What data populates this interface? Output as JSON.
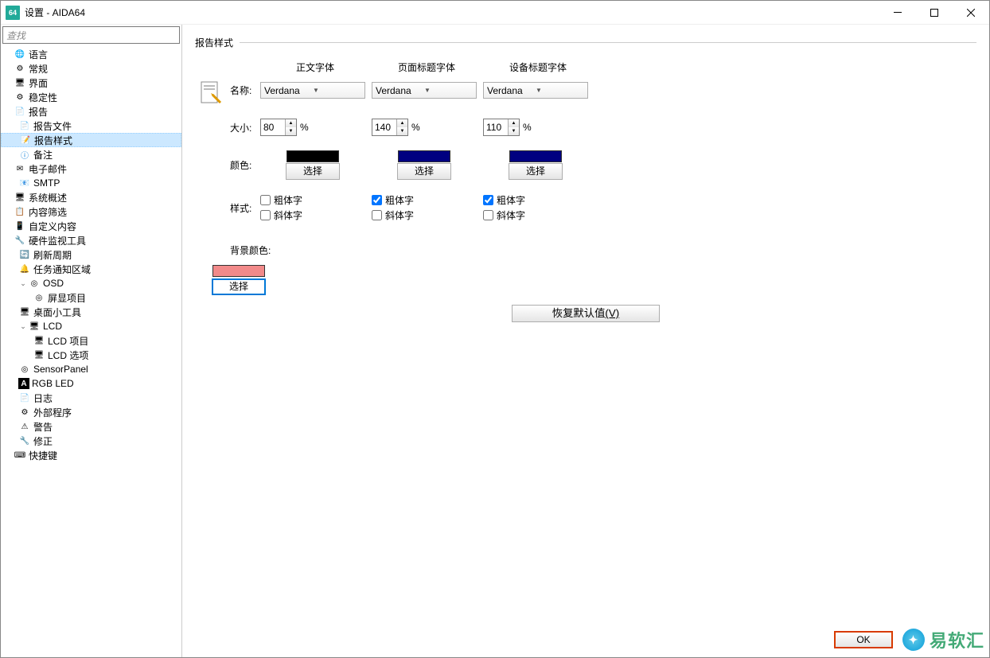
{
  "app_icon_text": "64",
  "window_title": "设置 - AIDA64",
  "search_placeholder": "查找",
  "tree": {
    "language": "语言",
    "general": "常规",
    "interface": "界面",
    "stability": "稳定性",
    "report": "报告",
    "report_file": "报告文件",
    "report_style": "报告样式",
    "remarks": "备注",
    "email": "电子邮件",
    "smtp": "SMTP",
    "sysoverview": "系统概述",
    "contentfilter": "内容筛选",
    "customcontent": "自定义内容",
    "hwmon": "硬件监视工具",
    "refresh": "刷新周期",
    "tasknotify": "任务通知区域",
    "osd": "OSD",
    "osd_items": "屏显项目",
    "gadget": "桌面小工具",
    "lcd": "LCD",
    "lcd_items": "LCD 项目",
    "lcd_options": "LCD 选项",
    "sensorpanel": "SensorPanel",
    "rgbled": "RGB LED",
    "log": "日志",
    "external": "外部程序",
    "alert": "警告",
    "fix": "修正",
    "hotkey": "快捷键"
  },
  "content": {
    "section_title": "报告样式",
    "col_body": "正文字体",
    "col_page": "页面标题字体",
    "col_device": "设备标题字体",
    "row_name": "名称:",
    "row_size": "大小:",
    "row_color": "颜色:",
    "row_style": "样式:",
    "font_body": "Verdana",
    "font_page": "Verdana",
    "font_device": "Verdana",
    "size_body": "80",
    "size_page": "140",
    "size_device": "110",
    "percent": "%",
    "select_label": "选择",
    "bold_label": "粗体字",
    "italic_label": "斜体字",
    "bold_body": false,
    "bold_page": true,
    "bold_device": true,
    "italic_body": false,
    "italic_page": false,
    "italic_device": false,
    "color_body": "#000000",
    "color_page": "#000080",
    "color_device": "#000080",
    "bg_section": "背景颜色:",
    "bg_color": "#f28a8a",
    "restore": "恢复默认值",
    "restore_key": "(V)",
    "ok": "OK"
  },
  "watermark": "易软汇"
}
